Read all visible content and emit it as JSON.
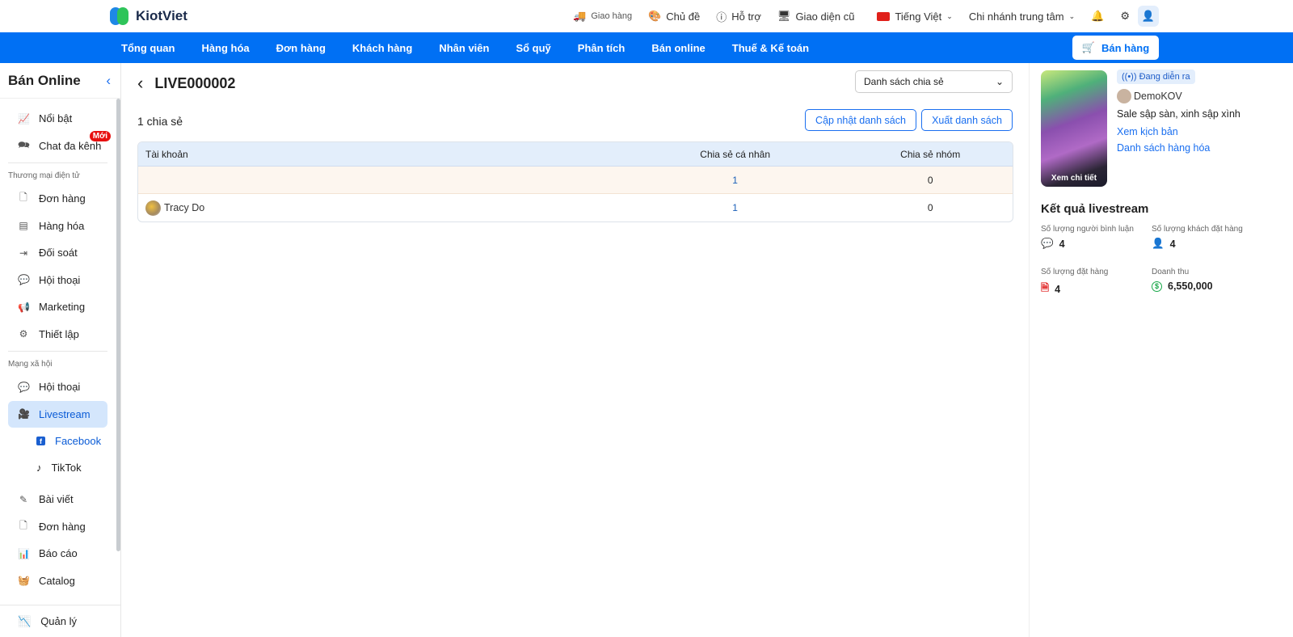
{
  "brand": {
    "name": "KiotViet"
  },
  "topbar": {
    "delivery": "Giao hàng",
    "theme": "Chủ đề",
    "support": "Hỗ trợ",
    "old_ui": "Giao diện cũ",
    "language": "Tiếng Việt",
    "branch": "Chi nhánh trung tâm"
  },
  "nav": {
    "items": [
      "Tổng quan",
      "Hàng hóa",
      "Đơn hàng",
      "Khách hàng",
      "Nhân viên",
      "Sổ quỹ",
      "Phân tích",
      "Bán online",
      "Thuế & Kế toán"
    ],
    "sell": "Bán hàng"
  },
  "sidebar": {
    "title": "Bán Online",
    "featured": "Nổi bật",
    "chat": "Chat đa kênh",
    "new_badge": "Mới",
    "sec_ecom": "Thương mại điện tử",
    "ecom": [
      "Đơn hàng",
      "Hàng hóa",
      "Đối soát",
      "Hội thoại",
      "Marketing",
      "Thiết lập"
    ],
    "sec_social": "Mạng xã hội",
    "social_chat": "Hội thoại",
    "livestream": "Livestream",
    "facebook": "Facebook",
    "tiktok": "TikTok",
    "more": [
      "Bài viết",
      "Đơn hàng",
      "Báo cáo",
      "Catalog"
    ],
    "manage": "Quản lý"
  },
  "main": {
    "title": "LIVE000002",
    "dropdown": "Danh sách chia sẻ",
    "count": "1 chia sẻ",
    "update_btn": "Cập nhật danh sách",
    "export_btn": "Xuất danh sách",
    "columns": [
      "Tài khoản",
      "Chia sẻ cá nhân",
      "Chia sẻ nhóm"
    ],
    "rows": [
      {
        "account": "",
        "personal": "1",
        "group": "0"
      },
      {
        "account": "Tracy Do",
        "personal": "1",
        "group": "0"
      }
    ]
  },
  "right": {
    "thumb_label": "Xem chi tiết",
    "status": "Đang diễn ra",
    "kol": "DemoKOV",
    "desc": "Sale sập sàn, xinh sập xình",
    "script_link": "Xem kịch bản",
    "products_link": "Danh sách hàng hóa",
    "results_title": "Kết quả livestream",
    "stats": [
      {
        "label": "Số lượng người bình luận",
        "value": "4"
      },
      {
        "label": "Số lượng khách đặt hàng",
        "value": "4"
      },
      {
        "label": "Số lượng đặt hàng",
        "value": "4"
      },
      {
        "label": "Doanh thu",
        "value": "6,550,000"
      }
    ]
  },
  "colors": {
    "primary": "#0070f4",
    "badge": "#e81010"
  }
}
